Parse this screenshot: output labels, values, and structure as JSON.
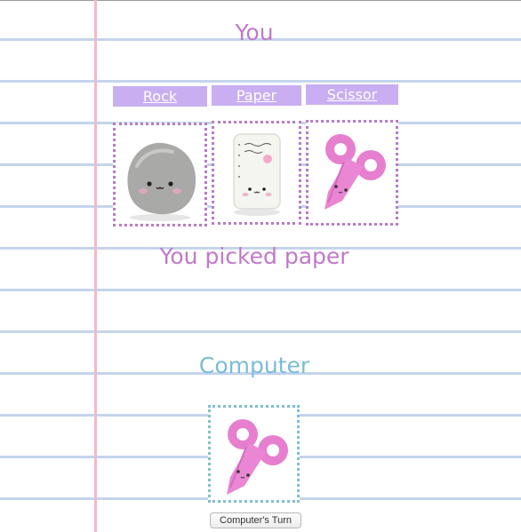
{
  "player": {
    "title": "You",
    "buttons": {
      "rock": "Rock",
      "paper": "Paper",
      "scissor": "Scissor"
    },
    "choices": [
      {
        "name": "rock",
        "icon": "rock-image"
      },
      {
        "name": "paper",
        "icon": "paper-image"
      },
      {
        "name": "scissor",
        "icon": "scissor-image"
      }
    ],
    "result": "You picked paper"
  },
  "computer": {
    "title": "Computer",
    "choice_icon": "scissor-image",
    "turn_button": "Computer's Turn"
  },
  "colors": {
    "player_accent": "#c079c9",
    "computer_accent": "#7bbcd6",
    "button_bg": "#c9aef1",
    "margin_line": "#f3b9c9",
    "ruled_line": "#c4d4ec"
  }
}
